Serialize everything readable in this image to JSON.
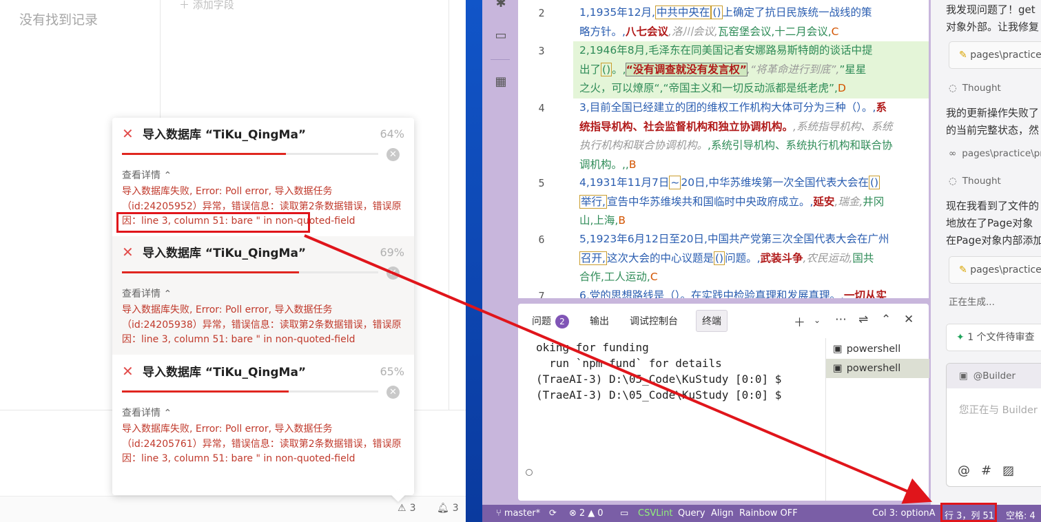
{
  "left_app": {
    "empty_text": "没有找到记录",
    "add_field": "添加字段",
    "status": {
      "warning_count": "3",
      "bell_count": "3"
    }
  },
  "notifications": [
    {
      "title": "导入数据库 “TiKu_QingMa”",
      "percent": "64%",
      "progress": 0.64,
      "detail_label": "查看详情",
      "message": "导入数据库失败, Error: Poll error, 导入数据任务（id:24205952）异常，错误信息：读取第2条数据错误，错误原因：line 3, column 51: bare \" in non-quoted-field"
    },
    {
      "title": "导入数据库 “TiKu_QingMa”",
      "percent": "69%",
      "progress": 0.69,
      "detail_label": "查看详情",
      "message": "导入数据库失败, Error: Poll error, 导入数据任务（id:24205938）异常，错误信息：读取第2条数据错误，错误原因：line 3, column 51: bare \" in non-quoted-field"
    },
    {
      "title": "导入数据库 “TiKu_QingMa”",
      "percent": "65%",
      "progress": 0.65,
      "detail_label": "查看详情",
      "message": "导入数据库失败, Error: Poll error, 导入数据任务（id:24205761）异常，错误信息：读取第2条数据错误，错误原因：line 3, column 51: bare \" in non-quoted-field"
    }
  ],
  "editor": {
    "line_numbers": [
      "2",
      "3",
      "4",
      "5",
      "6",
      "7"
    ],
    "lines": {
      "l2a": "1,1935年12月,",
      "l2b": "中共中央在",
      "l2c": "()",
      "l2d": "上确定了抗日民族统一战线的策",
      "l2e": "略方针。,",
      "l2f": "八七会议",
      "l2g": ",洛川会议,",
      "l2h": "瓦窑堡会议,十二月会议,",
      "l2i": "C",
      "l3a": "2,1946年8月,",
      "l3b": "毛泽东在同美国记者安娜路易斯特朗的谈话中提",
      "l3c": "出了",
      "l3d": "()",
      "l3e": "。,",
      "l3f": "“没有调查就没有发言权”",
      "l3g": ",“将革命进行到底”,",
      "l3h": "”星星",
      "l3i": "之火，可以燎原“,“帝国主义和一切反动派都是纸老虎”,",
      "l3j": "D",
      "l4a": "3,目前全国已经建立的团的维权工作机构大体可分为三种（）。,",
      "l4b": "系",
      "l4c": "统指导机构、社会监督机构和独立协调机构。",
      "l4d": ",系统指导机构、系统",
      "l4e": "执行机构和联合协调机构。",
      "l4f": ",系统引导机构、系统执行机构和联合协",
      "l4g": "调机构。,,",
      "l4h": "B",
      "l5a": "4,1931年11月7日",
      "l5b": "~",
      "l5c": "20日,",
      "l5d": "中华苏维埃第一次全国代表大会在",
      "l5e": "()",
      "l5f": "举行,",
      "l5g": "宣告中华苏维埃共和国临时中央政府成立。,",
      "l5h": "延安",
      "l5i": ",瑞金,",
      "l5j": "井冈",
      "l5k": "山,上海,",
      "l5l": "B",
      "l6a": "5,1923年6月12日至20日,",
      "l6b": "中国共产党第三次全国代表大会在广州",
      "l6c": "召开,",
      "l6d": "这次大会的中心议题是",
      "l6e": "()",
      "l6f": "问题。,",
      "l6g": "武装斗争",
      "l6h": ",农民运动,",
      "l6i": "国共",
      "l6j": "合作,工人运动,",
      "l6k": "C",
      "l7a": "6,党的思想路线是（）。在实践中检验真理和发展真理。,",
      "l7b": "一切从实"
    }
  },
  "panel": {
    "tabs": {
      "problems": "问题",
      "problems_count": "2",
      "output": "输出",
      "debug": "调试控制台",
      "terminal": "终端"
    },
    "terminal_lines": [
      "oking for funding",
      "  run `npm fund` for details",
      "(TraeAI-3) D:\\05_Code\\KuStudy [0:0] $",
      "(TraeAI-3) D:\\05_Code\\KuStudy [0:0] $"
    ],
    "shells": [
      "powershell",
      "powershell"
    ]
  },
  "chat": {
    "line1": "我发现问题了！get",
    "line2": "对象外部。让我修复",
    "chip1": "pages\\practice",
    "thought1": "Thought",
    "para1a": "我的更新操作失败了",
    "para1b": "的当前完整状态，然",
    "file_ref": "pages\\practice\\pr",
    "thought2": "Thought",
    "para2a": "现在我看到了文件的",
    "para2b": "地放在了Page对象",
    "para2c": "在Page对象内部添加",
    "chip2": "pages\\practice",
    "generating": "正在生成...",
    "pending": "1 个文件待审查",
    "builder": "@Builder",
    "input_placeholder": "您正在与 Builder"
  },
  "status_bar": {
    "branch": "master*",
    "errors": "2",
    "warnings": "0",
    "csvlint": "CSVLint",
    "query": "Query",
    "align": "Align",
    "rainbow": "Rainbow OFF",
    "col": "Col 3: optionA",
    "position": "行 3，列 51",
    "spaces": "空格: 4"
  },
  "colors": {
    "accent": "#7a5ea6",
    "error": "#e0261f",
    "annotation": "#e0151b"
  }
}
